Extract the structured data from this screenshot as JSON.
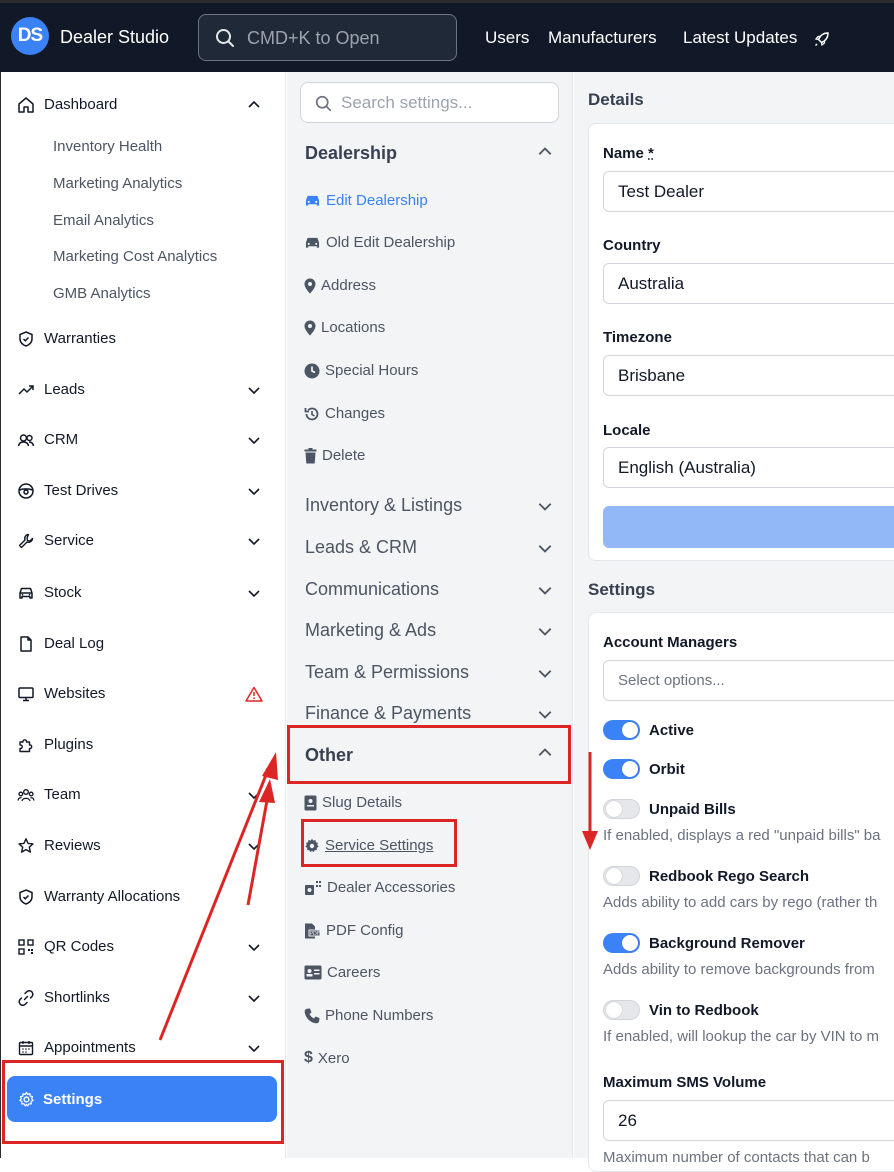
{
  "app": {
    "logo": "DS",
    "title": "Dealer Studio"
  },
  "search": {
    "placeholder": "CMD+K to Open"
  },
  "topnav": [
    "Users",
    "Manufacturers",
    "Latest Updates"
  ],
  "sidebar": {
    "dashboard": "Dashboard",
    "dashboard_sub": [
      "Inventory Health",
      "Marketing Analytics",
      "Email Analytics",
      "Marketing Cost Analytics",
      "GMB Analytics"
    ],
    "items": [
      {
        "label": "Warranties",
        "icon": "shield-check-icon"
      },
      {
        "label": "Leads",
        "icon": "trending-up-icon"
      },
      {
        "label": "CRM",
        "icon": "users-icon"
      },
      {
        "label": "Test Drives",
        "icon": "steering-wheel-icon"
      },
      {
        "label": "Service",
        "icon": "wrench-icon"
      },
      {
        "label": "Stock",
        "icon": "car-icon"
      },
      {
        "label": "Deal Log",
        "icon": "document-icon"
      },
      {
        "label": "Websites",
        "icon": "monitor-icon"
      },
      {
        "label": "Plugins",
        "icon": "puzzle-icon"
      },
      {
        "label": "Team",
        "icon": "team-icon"
      },
      {
        "label": "Reviews",
        "icon": "star-icon"
      },
      {
        "label": "Warranty Allocations",
        "icon": "shield-check-icon"
      },
      {
        "label": "QR Codes",
        "icon": "qr-code-icon"
      },
      {
        "label": "Shortlinks",
        "icon": "link-icon"
      },
      {
        "label": "Appointments",
        "icon": "calendar-icon"
      }
    ],
    "settings": "Settings"
  },
  "settings_nav": {
    "search_placeholder": "Search settings...",
    "dealership": "Dealership",
    "dealership_items": [
      "Edit Dealership",
      "Old Edit Dealership",
      "Address",
      "Locations",
      "Special Hours",
      "Changes",
      "Delete"
    ],
    "groups": [
      "Inventory & Listings",
      "Leads & CRM",
      "Communications",
      "Marketing & Ads",
      "Team & Permissions",
      "Finance & Payments"
    ],
    "other": "Other",
    "other_items": [
      "Slug Details",
      "Service Settings",
      "Dealer Accessories",
      "PDF Config",
      "Careers",
      "Phone Numbers",
      "Xero"
    ]
  },
  "details": {
    "title": "Details",
    "name_label": "Name",
    "name_required": "*",
    "name_value": "Test Dealer",
    "country_label": "Country",
    "country_value": "Australia",
    "timezone_label": "Timezone",
    "timezone_value": "Brisbane",
    "locale_label": "Locale",
    "locale_value": "English (Australia)"
  },
  "settings": {
    "title": "Settings",
    "account_managers_label": "Account Managers",
    "account_managers_placeholder": "Select options...",
    "toggles": [
      {
        "label": "Active",
        "on": true,
        "desc": ""
      },
      {
        "label": "Orbit",
        "on": true,
        "desc": ""
      },
      {
        "label": "Unpaid Bills",
        "on": false,
        "desc": "If enabled, displays a red \"unpaid bills\" ba"
      },
      {
        "label": "Redbook Rego Search",
        "on": false,
        "desc": "Adds ability to add cars by rego (rather th"
      },
      {
        "label": "Background Remover",
        "on": true,
        "desc": "Adds ability to remove backgrounds from"
      },
      {
        "label": "Vin to Redbook",
        "on": false,
        "desc": "If enabled, will lookup the car by VIN to m"
      }
    ],
    "sms_label": "Maximum SMS Volume",
    "sms_value": "26",
    "sms_desc": "Maximum number of contacts that can b"
  },
  "colors": {
    "accent": "#3b82f6",
    "topbar": "#111827",
    "annotation": "#dc2626"
  }
}
